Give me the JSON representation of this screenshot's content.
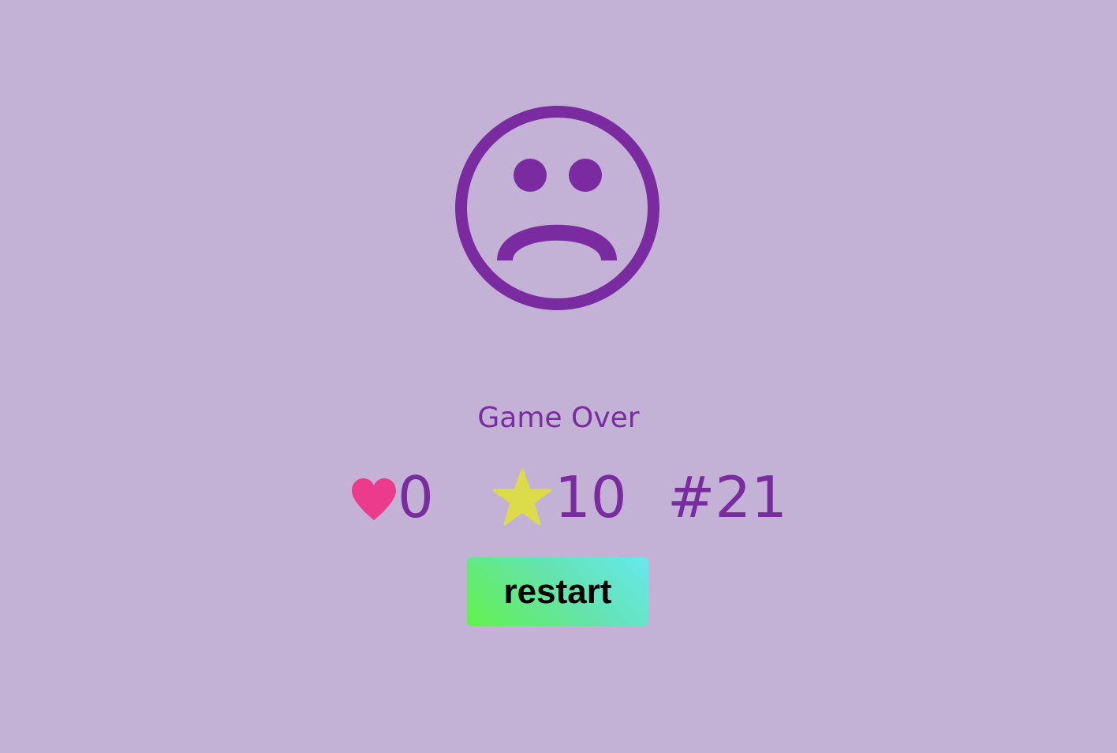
{
  "game_over": {
    "icon": "sad-face-icon",
    "title": "Game Over",
    "stats": {
      "lives": {
        "icon": "heart-icon",
        "value": "0",
        "color": "#ec3a8d"
      },
      "stars": {
        "icon": "star-icon",
        "value": "10",
        "color": "#dcdc4a"
      },
      "level": {
        "value": "#21"
      }
    },
    "restart_label": "restart"
  },
  "colors": {
    "background": "#c3b1d6",
    "accent": "#7a2ba0"
  }
}
